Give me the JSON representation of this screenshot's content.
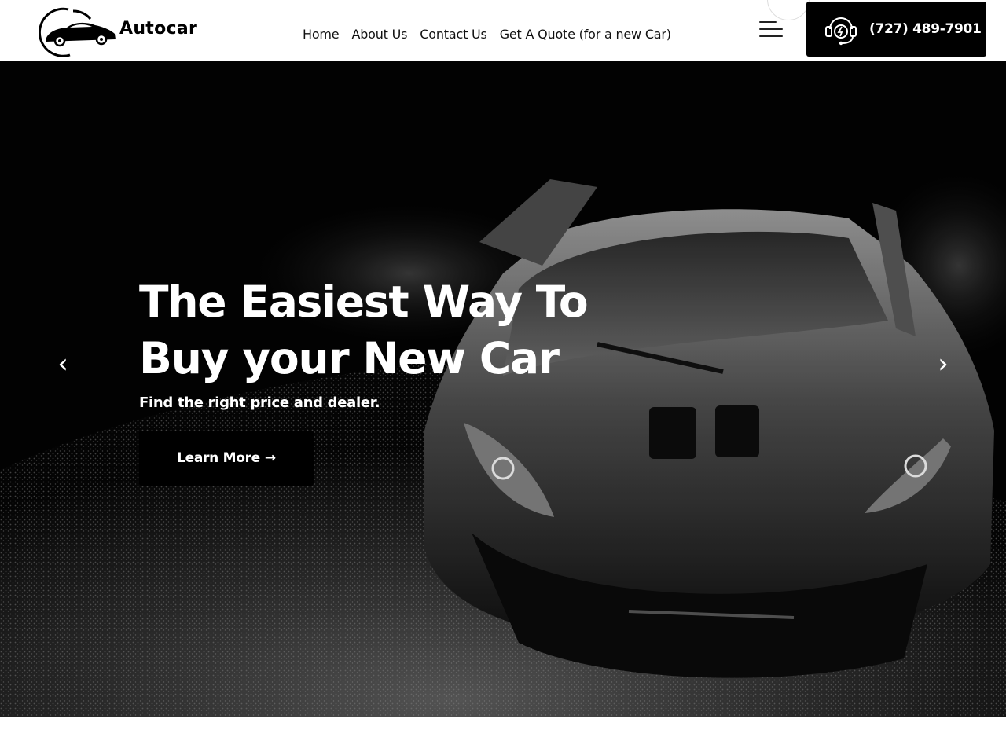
{
  "brand": {
    "name": "Autocar"
  },
  "nav": {
    "items": [
      {
        "label": "Home"
      },
      {
        "label": "About Us"
      },
      {
        "label": "Contact Us"
      },
      {
        "label": "Get A Quote (for a new Car)"
      }
    ]
  },
  "header": {
    "phone": "(727) 489-7901",
    "menu_icon": "hamburger-menu-icon",
    "phone_icon": "headset-support-icon"
  },
  "hero": {
    "title_line1": "The Easiest Way To",
    "title_line2": "Buy your New Car",
    "subtitle": "Find the right price and dealer.",
    "cta_label": "Learn More",
    "cta_arrow": "→",
    "prev_arrow": "‹",
    "next_arrow": "›",
    "background": "black-and-white sports car photo"
  },
  "colors": {
    "primary": "#000000",
    "text_on_dark": "#ffffff",
    "header_bg": "#ffffff"
  }
}
